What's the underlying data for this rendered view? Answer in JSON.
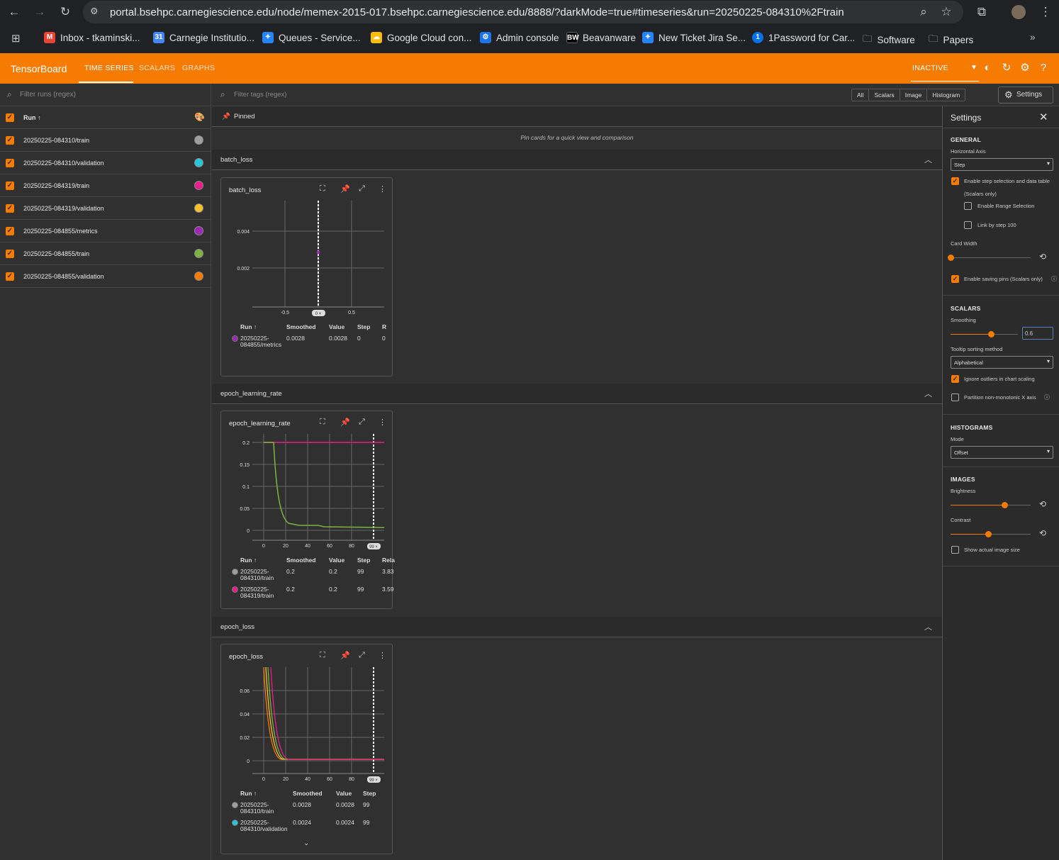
{
  "browser": {
    "url": "portal.bsehpc.carnegiescience.edu/node/memex-2015-017.bsehpc.carnegiescience.edu/8888/?darkMode=true#timeseries&run=20250225-084310%2Ftrain",
    "bookmarks": [
      "Inbox - tkaminski...",
      "Carnegie Institutio...",
      "Queues - Service...",
      "Google Cloud con...",
      "Admin console",
      "Beavanware",
      "New Ticket Jira Se...",
      "1Password for Car...",
      "Software",
      "Papers"
    ]
  },
  "header": {
    "title": "TensorBoard",
    "tabs": [
      "TIME SERIES",
      "SCALARS",
      "GRAPHS"
    ],
    "status": "INACTIVE"
  },
  "sidebar": {
    "filter_placeholder": "Filter runs (regex)",
    "column_header": "Run ↑",
    "runs": [
      {
        "name": "20250225-084310/train",
        "color": "#9e9e9e"
      },
      {
        "name": "20250225-084310/validation",
        "color": "#26c6da"
      },
      {
        "name": "20250225-084319/train",
        "color": "#e91e8c"
      },
      {
        "name": "20250225-084319/validation",
        "color": "#fbc02d"
      },
      {
        "name": "20250225-084855/metrics",
        "color": "#9c27b0"
      },
      {
        "name": "20250225-084855/train",
        "color": "#7cb342"
      },
      {
        "name": "20250225-084855/validation",
        "color": "#f57c00"
      }
    ]
  },
  "main": {
    "tag_filter_placeholder": "Filter tags (regex)",
    "type_filters": [
      "All",
      "Scalars",
      "Image",
      "Histogram"
    ],
    "settings_button": "Settings",
    "pinned_label": "Pinned",
    "pinned_hint": "Pin cards for a quick view and comparison",
    "sections": [
      "batch_loss",
      "epoch_learning_rate",
      "epoch_loss"
    ]
  },
  "cards": [
    {
      "title": "batch_loss",
      "yticks": [
        "0.004",
        "0.002"
      ],
      "xticks": [
        "-0.5",
        "0.5"
      ],
      "step_badge": "0 ×",
      "columns": [
        "Run ↑",
        "Smoothed",
        "Value",
        "Step",
        "R"
      ],
      "rows": [
        {
          "run1": "20250225-",
          "run2": "084855/metrics",
          "smoothed": "0.0028",
          "value": "0.0028",
          "step": "0",
          "rel": "0",
          "color": "#9c27b0"
        }
      ]
    },
    {
      "title": "epoch_learning_rate",
      "yticks": [
        "0.2",
        "0.15",
        "0.1",
        "0.05",
        "0"
      ],
      "xticks": [
        "0",
        "20",
        "40",
        "60",
        "80"
      ],
      "step_badge": "99 ×",
      "columns": [
        "Run ↑",
        "Smoothed",
        "Value",
        "Step",
        "Rela"
      ],
      "rows": [
        {
          "run1": "20250225-",
          "run2": "084310/train",
          "smoothed": "0.2",
          "value": "0.2",
          "step": "99",
          "rel": "3.83",
          "color": "#9e9e9e"
        },
        {
          "run1": "20250225-",
          "run2": "084319/train",
          "smoothed": "0.2",
          "value": "0.2",
          "step": "99",
          "rel": "3.59",
          "color": "#e91e8c"
        }
      ]
    },
    {
      "title": "epoch_loss",
      "yticks": [
        "0.06",
        "0.04",
        "0.02",
        "0"
      ],
      "xticks": [
        "0",
        "20",
        "40",
        "60",
        "80"
      ],
      "step_badge": "99 ×",
      "columns": [
        "Run ↑",
        "Smoothed",
        "Value",
        "Step"
      ],
      "rows": [
        {
          "run1": "20250225-",
          "run2": "084310/train",
          "smoothed": "0.0028",
          "value": "0.0028",
          "step": "99",
          "color": "#9e9e9e"
        },
        {
          "run1": "20250225-",
          "run2": "084310/validation",
          "smoothed": "0.0024",
          "value": "0.0024",
          "step": "99",
          "color": "#26c6da"
        }
      ]
    }
  ],
  "settings": {
    "title": "Settings",
    "general": {
      "heading": "GENERAL",
      "horizontal_axis_label": "Horizontal Axis",
      "horizontal_axis_value": "Step",
      "step_selection": "Enable step selection and data table",
      "step_selection_note": "(Scalars only)",
      "range_selection": "Enable Range Selection",
      "link_by_step": "Link by step 100",
      "card_width_label": "Card Width",
      "card_width_level": 0.0,
      "saving_pins": "Enable saving pins (Scalars only)"
    },
    "scalars": {
      "heading": "SCALARS",
      "smoothing_label": "Smoothing",
      "smoothing_value": "0.6",
      "tooltip_label": "Tooltip sorting method",
      "tooltip_value": "Alphabetical",
      "ignore_outliers": "Ignore outliers in chart scaling",
      "partition": "Partition non-monotonic X axis"
    },
    "histograms": {
      "heading": "HISTOGRAMS",
      "mode_label": "Mode",
      "mode_value": "Offset"
    },
    "images": {
      "heading": "IMAGES",
      "brightness_label": "Brightness",
      "brightness_level": 0.67,
      "contrast_label": "Contrast",
      "contrast_level": 0.47,
      "actual_size": "Show actual image size"
    }
  }
}
